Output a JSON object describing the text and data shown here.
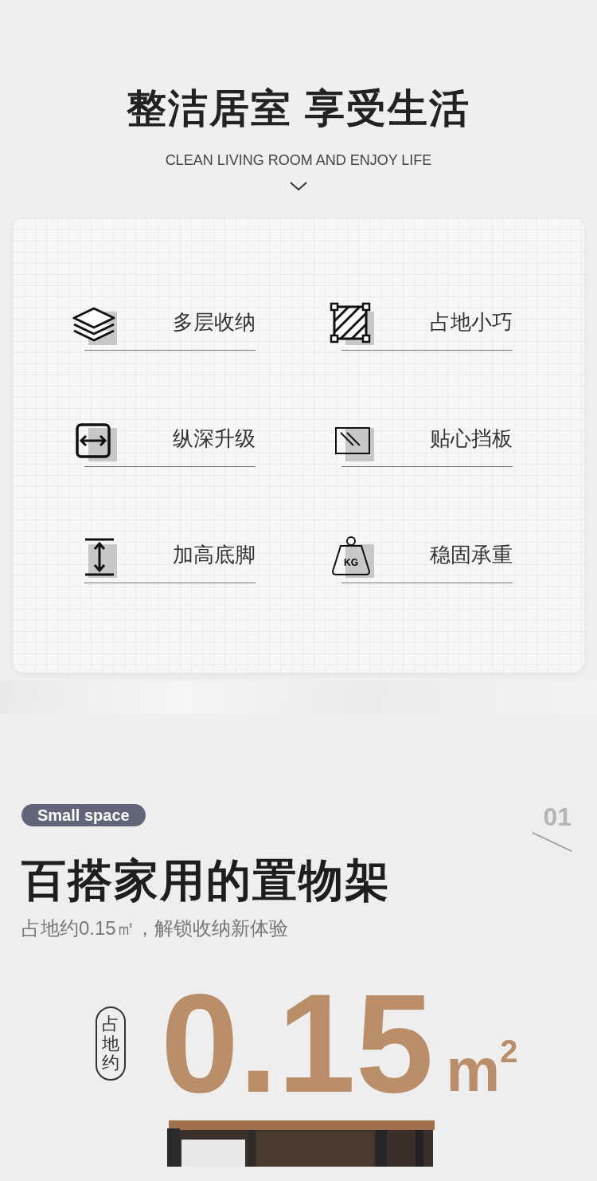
{
  "header": {
    "title": "整洁居室 享受生活",
    "subtitle": "CLEAN LIVING ROOM AND ENJOY LIFE"
  },
  "features": [
    {
      "kind": "layers",
      "label": "多层收纳"
    },
    {
      "kind": "area",
      "label": "占地小巧"
    },
    {
      "kind": "depth",
      "label": "纵深升级"
    },
    {
      "kind": "panel",
      "label": "贴心挡板"
    },
    {
      "kind": "height",
      "label": "加高底脚"
    },
    {
      "kind": "weight",
      "label": "稳固承重",
      "icon_text": "KG"
    }
  ],
  "section": {
    "tag": "Small space",
    "index": "01",
    "title": "百搭家用的置物架",
    "subtitle": "占地约0.15㎡，解锁收纳新体验",
    "area": {
      "label": "占地约",
      "value": "0.15",
      "unit": "m$^{2}$"
    }
  }
}
